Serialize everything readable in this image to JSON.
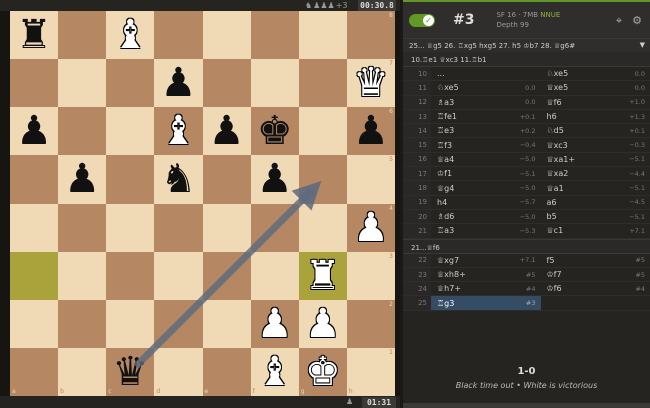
{
  "top": {
    "material_icons": [
      "knight-icon",
      "pawn-icon",
      "pawn-icon",
      "pawn-icon"
    ],
    "material_diff": "+3",
    "clock": "00:30.8"
  },
  "bottom": {
    "clock": "01:31"
  },
  "board": {
    "rank_labels": [
      "8",
      "7",
      "6",
      "5",
      "4",
      "3",
      "2",
      "1"
    ],
    "file_labels": [
      "a",
      "b",
      "c",
      "d",
      "e",
      "f",
      "g",
      "h"
    ],
    "highlight_squares": [
      "a3",
      "g3"
    ],
    "arrow": {
      "from": "c1",
      "to": "g5",
      "color": "#5b6a7d"
    },
    "pieces": [
      {
        "sq": "a8",
        "color": "b",
        "type": "rook",
        "glyph": "♜"
      },
      {
        "sq": "c8",
        "color": "w",
        "type": "bishop",
        "glyph": "♝"
      },
      {
        "sq": "h7",
        "color": "w",
        "type": "queen",
        "glyph": "♛"
      },
      {
        "sq": "d7",
        "color": "b",
        "type": "pawn",
        "glyph": "♟"
      },
      {
        "sq": "a6",
        "color": "b",
        "type": "pawn",
        "glyph": "♟"
      },
      {
        "sq": "d6",
        "color": "w",
        "type": "bishop",
        "glyph": "♝"
      },
      {
        "sq": "e6",
        "color": "b",
        "type": "pawn",
        "glyph": "♟"
      },
      {
        "sq": "f6",
        "color": "b",
        "type": "king",
        "glyph": "♚"
      },
      {
        "sq": "h6",
        "color": "b",
        "type": "pawn",
        "glyph": "♟"
      },
      {
        "sq": "b5",
        "color": "b",
        "type": "pawn",
        "glyph": "♟"
      },
      {
        "sq": "d5",
        "color": "b",
        "type": "knight",
        "glyph": "♞"
      },
      {
        "sq": "f5",
        "color": "b",
        "type": "pawn",
        "glyph": "♟"
      },
      {
        "sq": "h4",
        "color": "w",
        "type": "pawn",
        "glyph": "♟"
      },
      {
        "sq": "g3",
        "color": "w",
        "type": "rook",
        "glyph": "♜"
      },
      {
        "sq": "f2",
        "color": "w",
        "type": "pawn",
        "glyph": "♟"
      },
      {
        "sq": "g2",
        "color": "w",
        "type": "pawn",
        "glyph": "♟"
      },
      {
        "sq": "c1",
        "color": "b",
        "type": "queen",
        "glyph": "♛"
      },
      {
        "sq": "f1",
        "color": "w",
        "type": "bishop",
        "glyph": "♝"
      },
      {
        "sq": "g1",
        "color": "w",
        "type": "king",
        "glyph": "♚"
      }
    ]
  },
  "ceval": {
    "eval": "#3",
    "engine": "SF 16 · 7MB",
    "nnue": "NNUE",
    "depth": "Depth 99",
    "pv": "25... ♕g5 26. ♖xg5 hxg5 27. h5 ♔b7 28. ♕g6#"
  },
  "comments": {
    "line1": "10.♖e1 ♕xc3 11.♖b1",
    "line2": "21...♕f6"
  },
  "moves_a": [
    {
      "num": "10",
      "white": "...",
      "wev": "",
      "black": "♘xe5",
      "bev": "0.0"
    },
    {
      "num": "11",
      "white": "♘xe5",
      "wev": "0.0",
      "black": "♕xe5",
      "bev": "0.0"
    },
    {
      "num": "12",
      "white": "♗a3",
      "wev": "0.0",
      "black": "♕f6",
      "bev": "+1.0"
    },
    {
      "num": "13",
      "white": "♖fe1",
      "wev": "+0.1",
      "black": "h6",
      "bev": "+1.3"
    },
    {
      "num": "14",
      "white": "♖e3",
      "wev": "+0.2",
      "black": "♘d5",
      "bev": "+0.1"
    },
    {
      "num": "15",
      "white": "♖f3",
      "wev": "−0.4",
      "black": "♕xc3",
      "bev": "−0.3"
    },
    {
      "num": "16",
      "white": "♕a4",
      "wev": "−5.0",
      "black": "♕xa1+",
      "bev": "−5.1"
    },
    {
      "num": "17",
      "white": "♔f1",
      "wev": "−5.1",
      "black": "♕xa2",
      "bev": "−4.4"
    },
    {
      "num": "18",
      "white": "♕g4",
      "wev": "−5.0",
      "black": "♕a1",
      "bev": "−5.1"
    },
    {
      "num": "19",
      "white": "h4",
      "wev": "−5.7",
      "black": "a6",
      "bev": "−4.5"
    },
    {
      "num": "20",
      "white": "♗d6",
      "wev": "−5.0",
      "black": "b5",
      "bev": "−5.1"
    },
    {
      "num": "21",
      "white": "♖a3",
      "wev": "−5.3",
      "black": "♕c1",
      "bev": "+7.1"
    }
  ],
  "moves_b": [
    {
      "num": "22",
      "white": "♕xg7",
      "wev": "+7.1",
      "black": "f5",
      "bev": "#5"
    },
    {
      "num": "23",
      "white": "♕xh8+",
      "wev": "#5",
      "black": "♔f7",
      "bev": "#5"
    },
    {
      "num": "24",
      "white": "♕h7+",
      "wev": "#4",
      "black": "♔f6",
      "bev": "#4"
    },
    {
      "num": "25",
      "white": "♖g3",
      "wev": "#3",
      "black": "",
      "bev": ""
    }
  ],
  "result": {
    "score": "1-0",
    "status": "Black time out • White is victorious"
  }
}
